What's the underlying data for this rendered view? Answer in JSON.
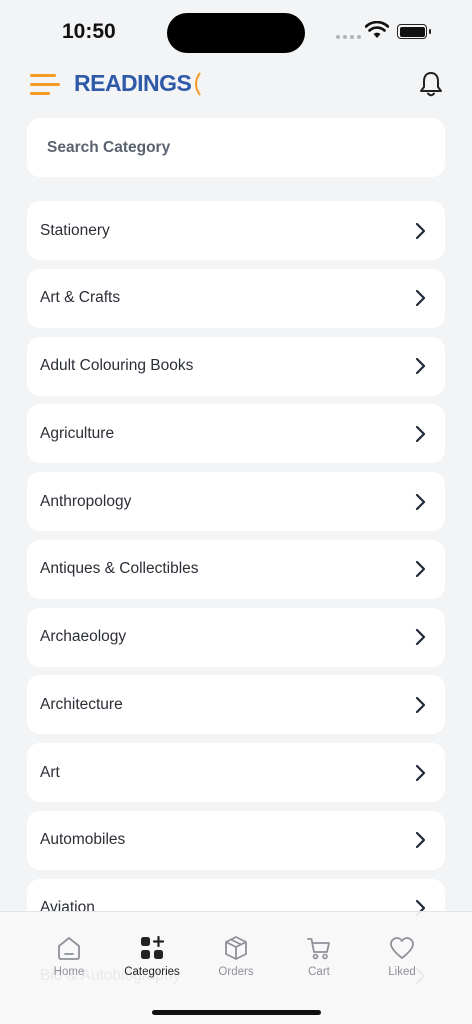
{
  "status_bar": {
    "time": "10:50"
  },
  "header": {
    "logo_text": "READINGS"
  },
  "search": {
    "placeholder": "Search Category"
  },
  "categories": [
    "Stationery",
    "Art & Crafts",
    "Adult Colouring Books",
    "Agriculture",
    "Anthropology",
    "Antiques & Collectibles",
    "Archaeology",
    "Architecture",
    "Art",
    "Automobiles",
    "Aviation",
    "Bio & Autobiography"
  ],
  "tabs": [
    {
      "label": "Home",
      "icon": "home-icon"
    },
    {
      "label": "Categories",
      "icon": "categories-icon"
    },
    {
      "label": "Orders",
      "icon": "package-icon"
    },
    {
      "label": "Cart",
      "icon": "cart-icon"
    },
    {
      "label": "Liked",
      "icon": "heart-icon"
    }
  ],
  "active_tab": "Categories",
  "colors": {
    "accent": "#f59a23",
    "brand": "#2f5aa8",
    "background": "#f3f4f6"
  }
}
